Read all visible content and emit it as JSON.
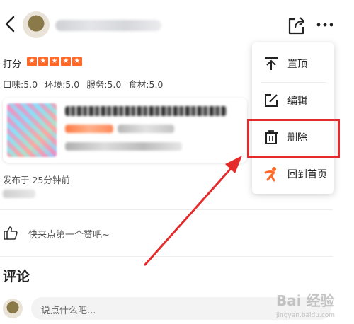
{
  "header": {
    "back_icon": "chevron-left-icon",
    "share_icon": "share-icon",
    "more_icon": "more-dots-icon"
  },
  "rating": {
    "label": "打分",
    "stars": 5,
    "scores": [
      "口味:5.0",
      "环境:5.0",
      "服务:5.0",
      "食材:5.0"
    ]
  },
  "post": {
    "posted_time": "发布于 25分钟前"
  },
  "like": {
    "prompt": "快来点第一个赞吧~"
  },
  "comments": {
    "title": "评论",
    "placeholder": "说点什么吧..."
  },
  "menu": {
    "items": [
      {
        "label": "置顶",
        "icon": "pin-top-icon"
      },
      {
        "label": "编辑",
        "icon": "edit-icon"
      },
      {
        "label": "删除",
        "icon": "trash-icon"
      },
      {
        "label": "回到首页",
        "icon": "home-figure-icon"
      }
    ]
  },
  "annotation": {
    "highlight_color": "#e42a2a",
    "arrow_color": "#e42a2a"
  },
  "watermark": {
    "text": "Bai 经验",
    "subtext": "jingyan.baidu.com"
  },
  "colors": {
    "star": "#ff6a2b",
    "menu_home_icon": "#ff6a2b"
  }
}
